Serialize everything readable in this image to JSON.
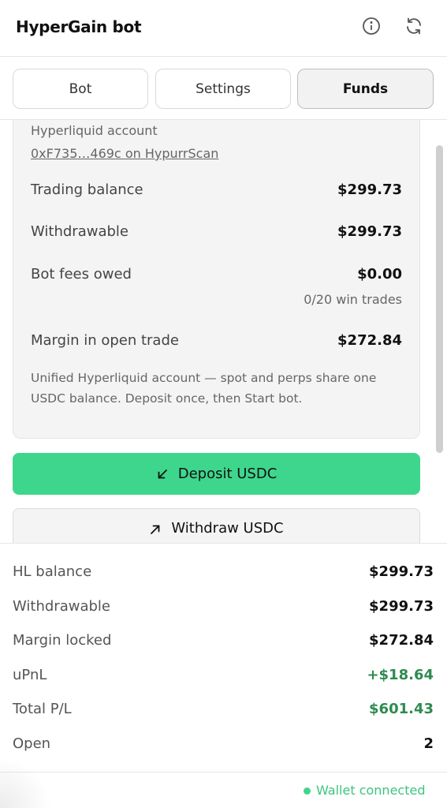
{
  "header": {
    "title": "HyperGain bot",
    "icons": [
      "info-icon",
      "refresh-icon"
    ]
  },
  "tabs": [
    {
      "label": "Bot",
      "active": false
    },
    {
      "label": "Settings",
      "active": false
    },
    {
      "label": "Funds",
      "active": true
    }
  ],
  "account": {
    "label": "Hyperliquid account",
    "link_text": "0xF735…469c on HypurrScan"
  },
  "balances": {
    "trading_label": "Trading balance",
    "trading_value": "$299.73",
    "withdrawable_label": "Withdrawable",
    "withdrawable_value": "$299.73",
    "fees_label": "Bot fees owed",
    "fees_value": "$0.00",
    "fees_sub": "0/20 win trades",
    "margin_label": "Margin in open trade",
    "margin_value": "$272.84"
  },
  "note": "Unified Hyperliquid account — spot and perps share one USDC balance. Deposit once, then Start bot.",
  "actions": {
    "deposit_label": "Deposit USDC",
    "withdraw_label": "Withdraw USDC"
  },
  "summary": [
    {
      "label": "HL balance",
      "value": "$299.73",
      "tone": "default"
    },
    {
      "label": "Withdrawable",
      "value": "$299.73",
      "tone": "default"
    },
    {
      "label": "Margin locked",
      "value": "$272.84",
      "tone": "default"
    },
    {
      "label": "uPnL",
      "value": "+$18.64",
      "tone": "positive"
    },
    {
      "label": "Total P/L",
      "value": "$601.43",
      "tone": "positive"
    },
    {
      "label": "Open",
      "value": "2",
      "tone": "default"
    }
  ],
  "footer": {
    "status": "Wallet connected"
  },
  "colors": {
    "accent_green": "#3ed68c",
    "positive_text": "#2e8b4f"
  }
}
